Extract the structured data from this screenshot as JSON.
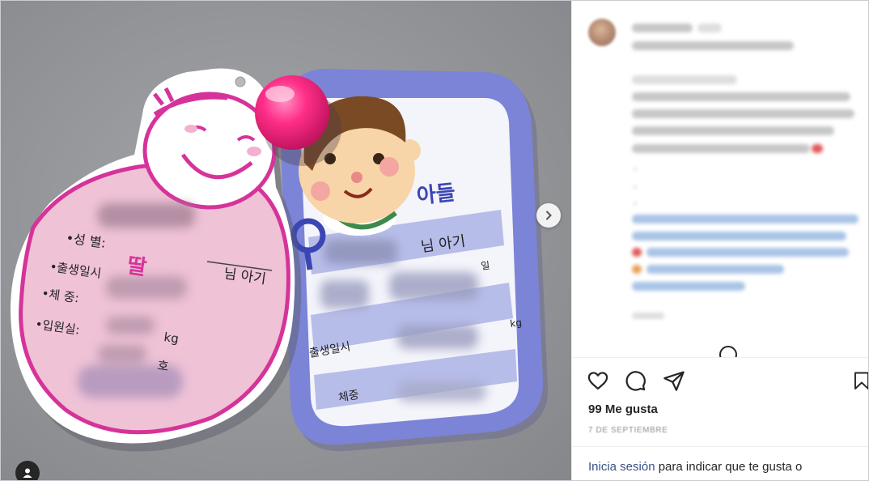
{
  "post": {
    "likes": "99 Me gusta",
    "date": "7 DE SEPTIEMBRE"
  },
  "login": {
    "link": "Inicia sesión",
    "rest": "para indicar que te gusta o"
  },
  "tags": {
    "pink": {
      "gender_label": "•성  별:",
      "gender_value": "딸",
      "baby": "님 아기",
      "birth_label": "•출생일시",
      "weight_label": "•체  중:",
      "room_label": "•입원실:",
      "unit_kg": "kg",
      "unit_ho": "호"
    },
    "blue": {
      "title": "아들",
      "baby": "님 아기",
      "day": "일",
      "birth_label": "출생일시",
      "weight_label": "체중",
      "unit_kg": "kg"
    }
  },
  "colors": {
    "accent_link": "#385185",
    "pink_card": "#efc2d6",
    "pink_stroke": "#d6339a",
    "blue_card": "#7b84d6",
    "magnet": "#ff2e88"
  },
  "icons": [
    "heart-icon",
    "comment-icon",
    "share-icon",
    "bookmark-icon",
    "chevron-right-icon",
    "user-tag-icon"
  ]
}
